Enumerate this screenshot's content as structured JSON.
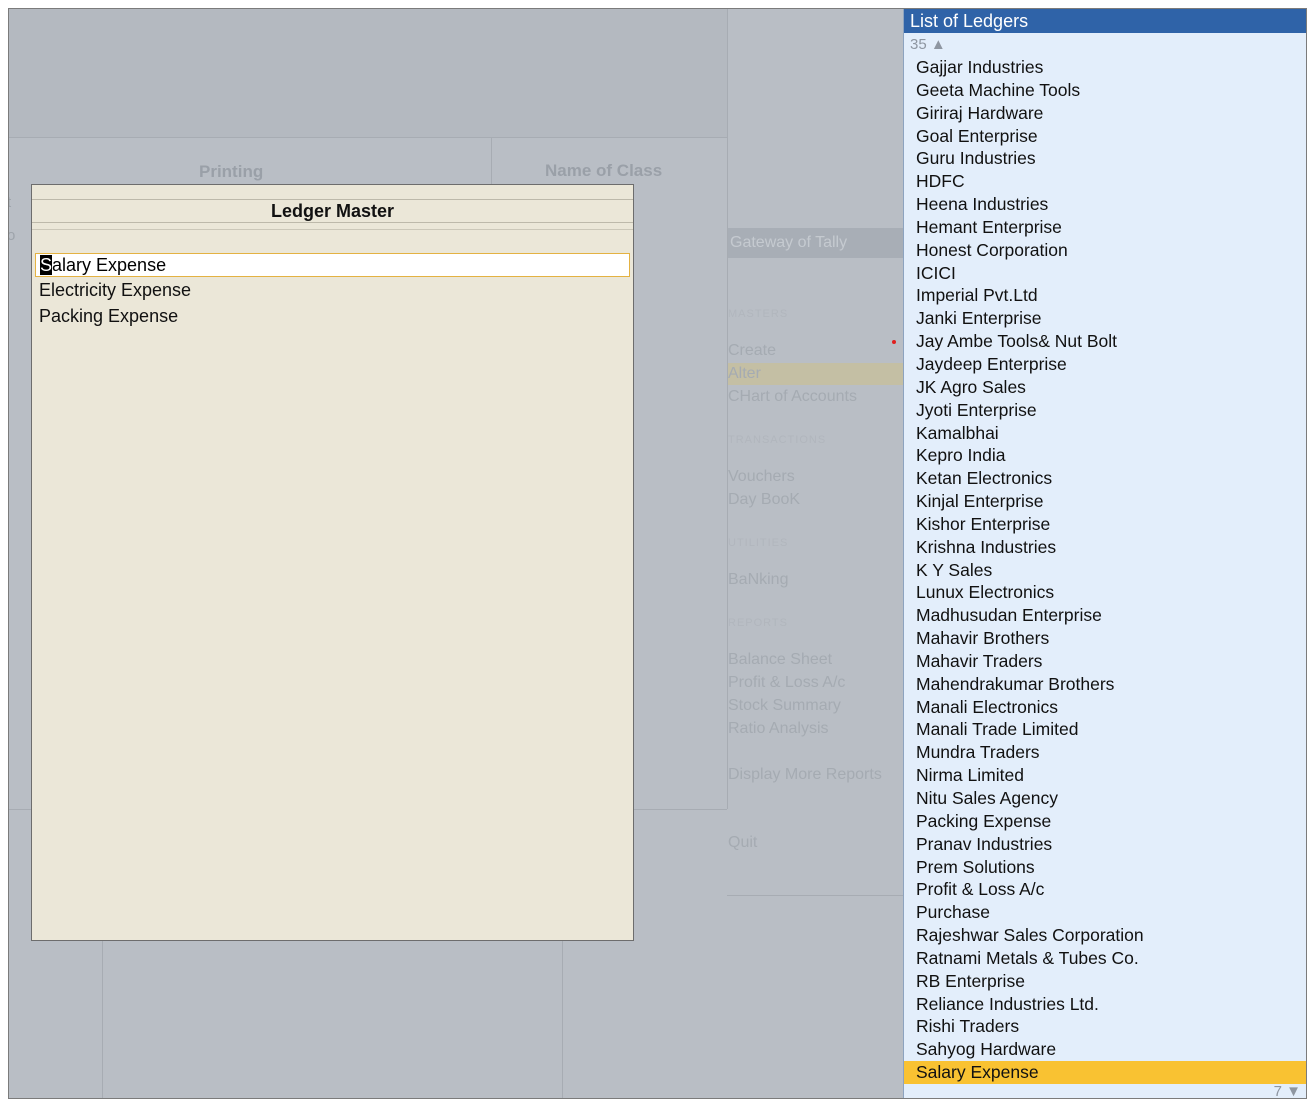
{
  "background": {
    "column_headers": [
      "Printing",
      "Name of Class"
    ],
    "edge_fragments": [
      "t",
      "o"
    ],
    "gateway": {
      "title": "Gateway of Tally",
      "sections": [
        {
          "heading": "MASTERS",
          "items": [
            "Create",
            "Alter",
            "CHart of Accounts"
          ]
        },
        {
          "heading": "TRANSACTIONS",
          "items": [
            "Vouchers",
            "Day BooK"
          ]
        },
        {
          "heading": "UTILITIES",
          "items": [
            "BaNking"
          ]
        },
        {
          "heading": "REPORTS",
          "items": [
            "Balance Sheet",
            "Profit & Loss A/c",
            "Stock Summary",
            "Ratio Analysis"
          ]
        },
        {
          "heading": "",
          "items": [
            "Display More Reports"
          ]
        },
        {
          "heading": "",
          "items": [
            "Quit"
          ]
        }
      ]
    }
  },
  "ledger_master": {
    "title": "Ledger Master",
    "input_value": "Salary Expense",
    "input_first_char": "S",
    "input_rest": "alary Expense",
    "items": [
      "Electricity Expense",
      "Packing Expense"
    ]
  },
  "ledger_list": {
    "title": "List of Ledgers",
    "above_count": "35 ▲",
    "below_count": "7 ▼",
    "selected": "Salary Expense",
    "items": [
      "Gajjar Industries",
      "Geeta Machine Tools",
      "Giriraj Hardware",
      "Goal Enterprise",
      "Guru Industries",
      "HDFC",
      "Heena Industries",
      "Hemant Enterprise",
      "Honest Corporation",
      "ICICI",
      "Imperial Pvt.Ltd",
      "Janki Enterprise",
      "Jay Ambe Tools& Nut Bolt",
      "Jaydeep Enterprise",
      "JK Agro Sales",
      "Jyoti Enterprise",
      "Kamalbhai",
      "Kepro India",
      "Ketan Electronics",
      "Kinjal Enterprise",
      "Kishor Enterprise",
      "Krishna Industries",
      "K Y Sales",
      "Lunux Electronics",
      "Madhusudan Enterprise",
      "Mahavir Brothers",
      "Mahavir Traders",
      "Mahendrakumar Brothers",
      "Manali Electronics",
      "Manali Trade Limited",
      "Mundra Traders",
      "Nirma Limited",
      "Nitu Sales Agency",
      "Packing Expense",
      "Pranav Industries",
      "Prem Solutions",
      "Profit & Loss A/c",
      "Purchase",
      "Rajeshwar Sales Corporation",
      "Ratnami Metals & Tubes Co.",
      "RB Enterprise",
      "Reliance Industries Ltd.",
      "Rishi Traders",
      "Sahyog Hardware",
      "Salary Expense"
    ]
  },
  "colors": {
    "header_blue": "#2f63a8",
    "highlight": "#f9c232",
    "panel": "#ebe7d8",
    "list_bg": "#e3eefb"
  }
}
